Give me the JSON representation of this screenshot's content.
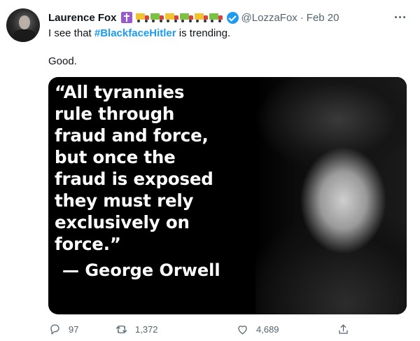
{
  "author": {
    "name": "Laurence Fox",
    "handle": "@LozzaFox",
    "separator": "·",
    "date": "Feb 20",
    "badge_icons": [
      "latin-cross-icon",
      "truck-icon",
      "truck-icon",
      "truck-icon",
      "truck-icon",
      "truck-icon",
      "truck-icon"
    ],
    "verified_icon": "verified-badge-icon"
  },
  "tweet": {
    "line1_prefix": "I see that ",
    "hashtag": "#BlackfaceHitler",
    "line1_suffix": " is trending.",
    "line2": "Good."
  },
  "media": {
    "quote_lines": [
      "“All tyrannies",
      "rule through",
      "fraud and force,",
      "but once the",
      "fraud is exposed",
      "they must rely",
      "exclusively on",
      "force.”"
    ],
    "attribution": "— George Orwell",
    "colors": {
      "background": "#000000",
      "text": "#ffffff"
    }
  },
  "actions": {
    "reply_count": "97",
    "retweet_count": "1,372",
    "like_count": "4,689",
    "icons": [
      "reply-icon",
      "retweet-icon",
      "like-icon",
      "share-icon"
    ]
  },
  "colors": {
    "accent": "#1d9bf0",
    "muted": "#536471",
    "text": "#0f1419"
  }
}
